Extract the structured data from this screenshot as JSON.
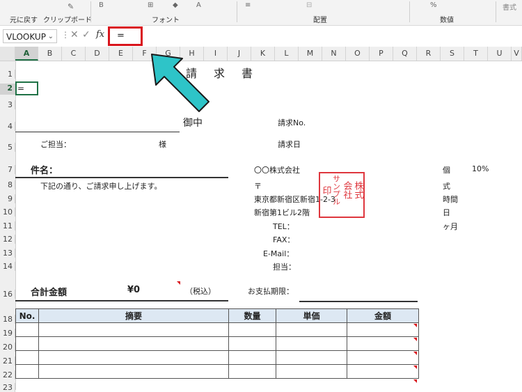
{
  "ribbon": {
    "undo_label": "元に戻す",
    "clipboard_label": "クリップボード",
    "font_label": "フォント",
    "alignment_label": "配置",
    "number_label": "数値",
    "style_label": "書式"
  },
  "formula_bar": {
    "name_box": "VLOOKUP",
    "formula": "="
  },
  "columns": [
    "A",
    "B",
    "C",
    "D",
    "E",
    "F",
    "G",
    "H",
    "I",
    "J",
    "K",
    "L",
    "M",
    "N",
    "O",
    "P",
    "Q",
    "R",
    "S",
    "T",
    "U",
    "V"
  ],
  "selected_column": "A",
  "rows": [
    "1",
    "2",
    "3",
    "4",
    "5",
    "7",
    "8",
    "9",
    "10",
    "11",
    "12",
    "13",
    "14",
    "16",
    "18",
    "19",
    "20",
    "21",
    "22",
    "23"
  ],
  "selected_row": "2",
  "cells": {
    "a2": "=",
    "title": "請　求　書",
    "onchu": "御中",
    "seikyu_no": "請求No.",
    "tantou": "ご担当：",
    "sama": "様",
    "seikyubi": "請求日",
    "kenmei": "件名：",
    "intro": "下記の通り、ご請求申し上げます。",
    "company": "〇〇株式会社",
    "postal": "〒",
    "address1": "東京都新宿区新宿1-2-3",
    "address2": "新宿第1ビル2階",
    "tel": "TEL：",
    "fax": "FAX：",
    "email": "E-Mail：",
    "tantou2": "担当：",
    "ko": "個",
    "percent": "10%",
    "shiki": "式",
    "jikan": "時間",
    "nichi": "日",
    "kagetsu": "ヶ月",
    "total_label": "合計金額",
    "total_value": "¥0",
    "tax_note": "（税込）",
    "payment_due": "お支払期限："
  },
  "stamp": {
    "lines": [
      "株式",
      "会社",
      "サンプル",
      "印"
    ],
    "color": "#d9141c"
  },
  "table": {
    "headers": [
      "No.",
      "摘要",
      "数量",
      "単価",
      "金額"
    ],
    "row_count": 5
  },
  "colors": {
    "accent_red": "#d9141c",
    "arrow_fill": "#2ec4c8",
    "table_header_bg": "#dde8f3"
  }
}
